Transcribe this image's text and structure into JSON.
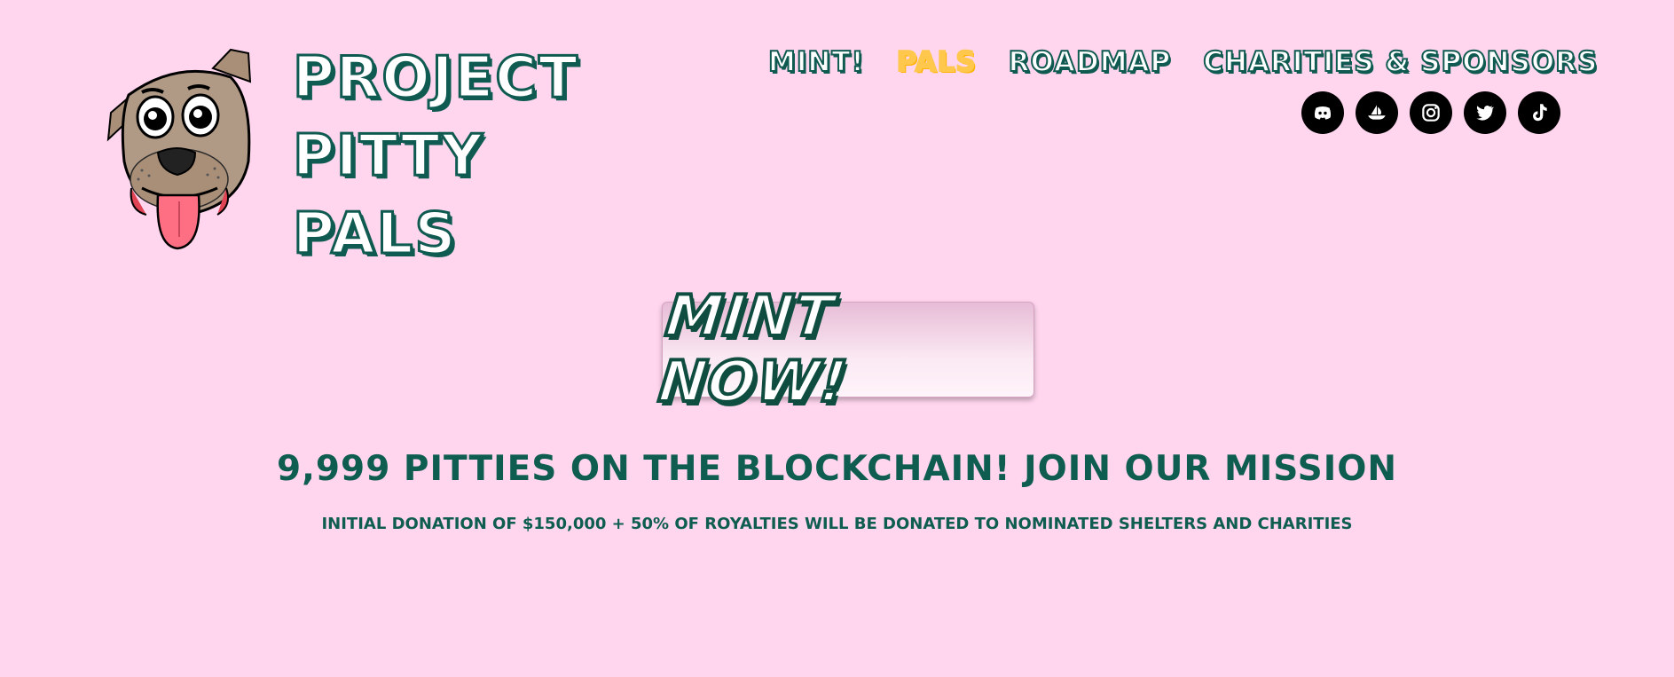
{
  "site": {
    "title_lines": [
      "PROJECT",
      "PITTY",
      "PALS"
    ]
  },
  "nav": {
    "items": [
      {
        "label": "MINT!"
      },
      {
        "label": "PALS",
        "active": true
      },
      {
        "label": "ROADMAP"
      },
      {
        "label": "CHARITIES & SPONSORS"
      }
    ]
  },
  "social": [
    {
      "name": "discord",
      "icon": "discord-icon"
    },
    {
      "name": "opensea",
      "icon": "opensea-icon"
    },
    {
      "name": "instagram",
      "icon": "instagram-icon"
    },
    {
      "name": "twitter",
      "icon": "twitter-icon"
    },
    {
      "name": "tiktok",
      "icon": "tiktok-icon"
    }
  ],
  "hero": {
    "mint_label": "MINT NOW!",
    "headline": "9,999 PITTIES ON THE BLOCKCHAIN! JOIN OUR MISSION",
    "subline": "INITIAL DONATION OF $150,000 + 50% OF ROYALTIES WILL BE DONATED TO NOMINATED SHELTERS AND CHARITIES"
  },
  "colors": {
    "background": "#ffd6ee",
    "brand_dark": "#0f5a51",
    "active_nav": "#ffc84c"
  }
}
